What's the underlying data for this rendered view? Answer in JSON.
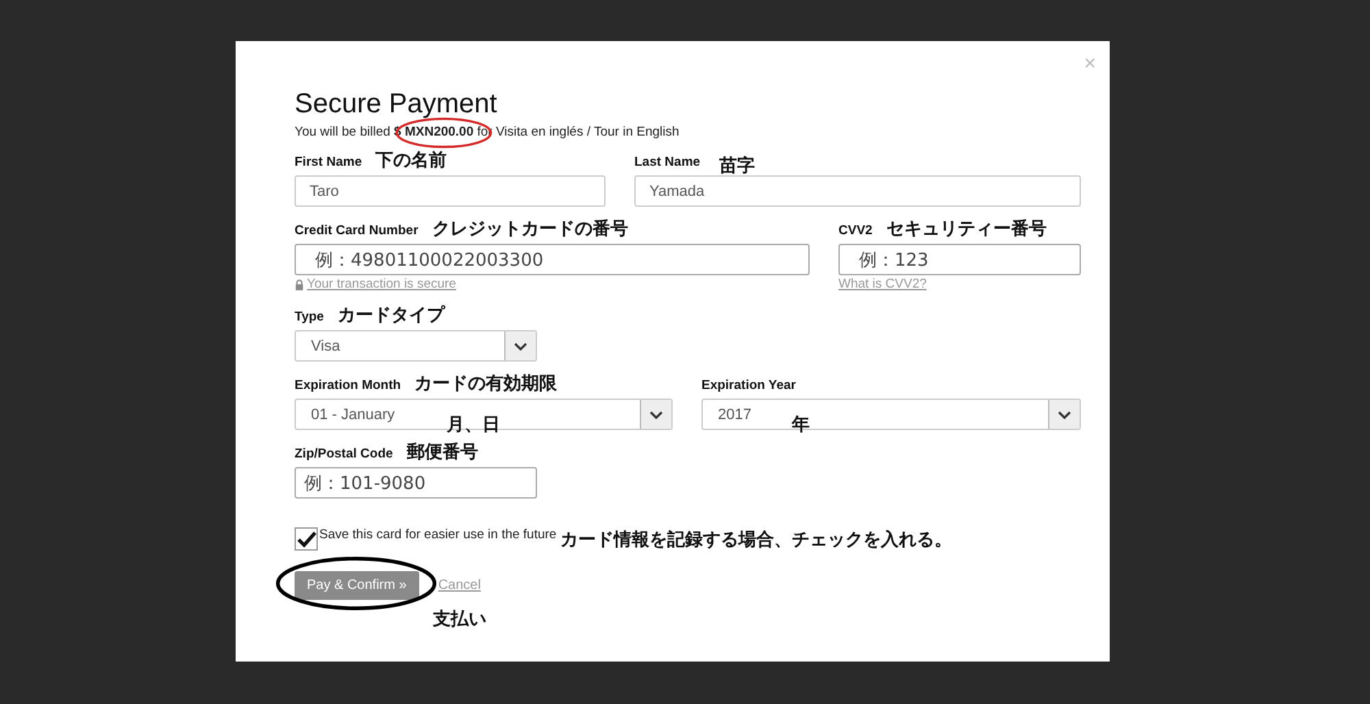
{
  "modal": {
    "title": "Secure Payment",
    "close": "×",
    "billing": {
      "text": "You will be billed **$ MXN200.00** for Visita en inglés / Tour in English",
      "circled": true
    },
    "first_name": {
      "label": "First Name",
      "value": "Taro",
      "note": "下の名前"
    },
    "last_name": {
      "label": "Last Name",
      "value": "Yamada",
      "note": "苗字"
    },
    "card_number": {
      "label": "Credit Card Number",
      "value": "例：49801100022003300",
      "note": "クレジットカードの番号",
      "link": "Your transaction is secure"
    },
    "cvv": {
      "label": "CVV2",
      "value": "例：123",
      "note": "セキュリティー番号",
      "link": "What is CVV2?"
    },
    "type": {
      "label": "Type",
      "value": "Visa",
      "note": "カードタイプ"
    },
    "exp_month": {
      "label": "Expiration Month",
      "value": "01 - January",
      "note": "カードの有効期限",
      "inner_note": "月、日"
    },
    "exp_year": {
      "label": "Expiration Year",
      "value": "2017",
      "inner_note": "年"
    },
    "zip": {
      "label": "Zip/Postal Code",
      "value": "例：101-9080",
      "note": "郵便番号"
    },
    "save_card": {
      "label": "Save this card for easier use in the future",
      "checked": true,
      "note": "カード情報を記録する場合、チェックを入れる。"
    },
    "pay_button": {
      "label": "Pay & Confirm »",
      "circled": true,
      "note": "支払い"
    },
    "cancel": "Cancel"
  }
}
